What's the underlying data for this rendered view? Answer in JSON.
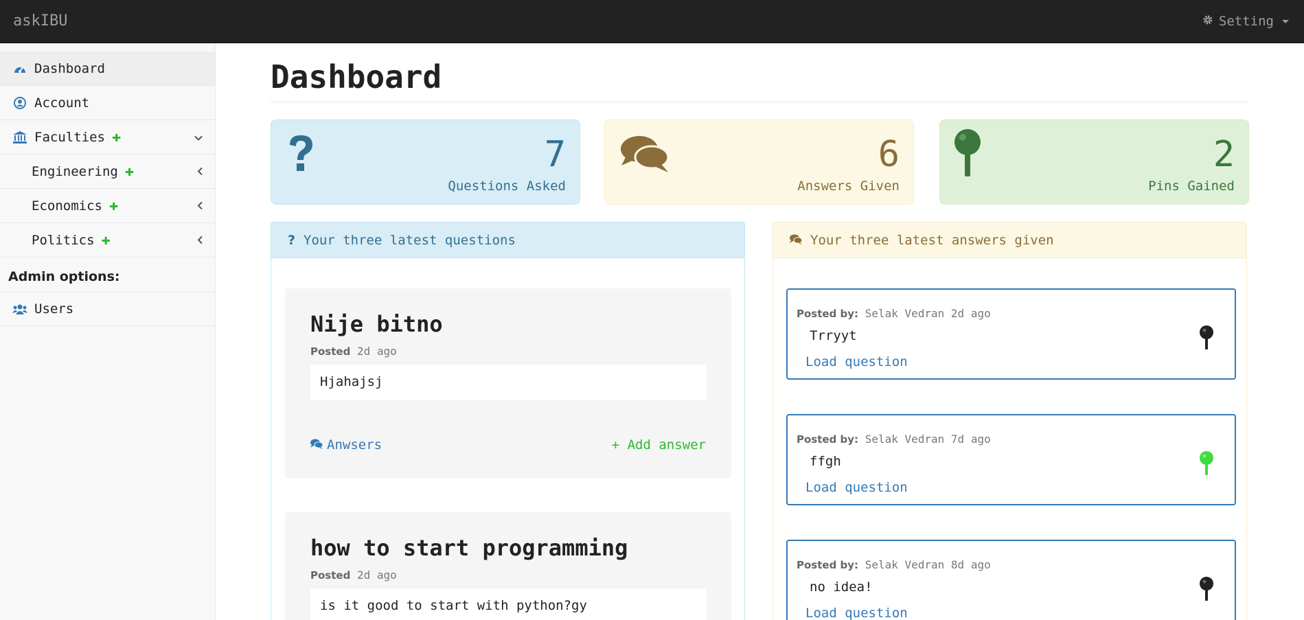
{
  "navbar": {
    "brand": "askIBU",
    "setting_label": "Setting"
  },
  "sidebar": {
    "items": [
      {
        "label": "Dashboard",
        "icon": "dashboard-icon"
      },
      {
        "label": "Account",
        "icon": "user-circle-icon"
      },
      {
        "label": "Faculties",
        "icon": "university-icon"
      },
      {
        "label": "Engineering"
      },
      {
        "label": "Economics"
      },
      {
        "label": "Politics"
      },
      {
        "label": "Users",
        "icon": "users-icon"
      }
    ],
    "plus": "✚",
    "admin_label": "Admin options:"
  },
  "main": {
    "title": "Dashboard",
    "stats": [
      {
        "value": "7",
        "caption": "Questions Asked",
        "icon": "question-icon",
        "color": "#31708f"
      },
      {
        "value": "6",
        "caption": "Answers Given",
        "icon": "comments-icon",
        "color": "#8a6d3b"
      },
      {
        "value": "2",
        "caption": "Pins Gained",
        "icon": "pin-icon",
        "color": "#3c763d"
      }
    ],
    "questions_panel": {
      "heading": "Your three latest questions",
      "questions": [
        {
          "title": "Nije bitno",
          "posted_label": "Posted",
          "time": "2d ago",
          "body": "Hjahajsj",
          "answers_label": "Anwsers",
          "add_label": "+ Add answer"
        },
        {
          "title": "how to start programming",
          "posted_label": "Posted",
          "time": "2d ago",
          "body": "is it good to start with python?gy"
        }
      ]
    },
    "answers_panel": {
      "heading": "Your three latest answers given",
      "answers": [
        {
          "posted_label": "Posted by:",
          "author": "Selak Vedran 2d ago",
          "text": "Trryyt",
          "load_label": "Load question",
          "pinned": false
        },
        {
          "posted_label": "Posted by:",
          "author": "Selak Vedran 7d ago",
          "text": "ffgh",
          "load_label": "Load question",
          "pinned": true
        },
        {
          "posted_label": "Posted by:",
          "author": "Selak Vedran 8d ago",
          "text": "no idea!",
          "load_label": "Load question",
          "pinned": false
        }
      ]
    }
  },
  "colors": {
    "brand_blue": "#337ab7",
    "success_green": "#2eb82e",
    "pin_active": "#3ddc3d",
    "pin_inactive": "#222222"
  }
}
